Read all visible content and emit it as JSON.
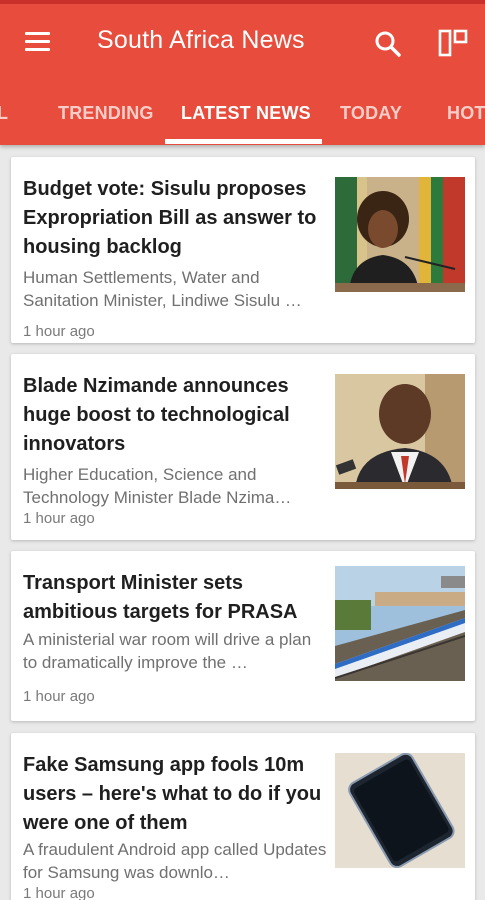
{
  "app": {
    "title": "South Africa News",
    "colors": {
      "primary": "#e74c3c",
      "status": "#c9302c"
    },
    "icons": {
      "menu": "menu-icon",
      "search": "search-icon",
      "layout": "layout-icon"
    }
  },
  "tabs": [
    {
      "label": "L",
      "active": false
    },
    {
      "label": "TRENDING",
      "active": false
    },
    {
      "label": "LATEST NEWS",
      "active": true
    },
    {
      "label": "TODAY",
      "active": false
    },
    {
      "label": "HOT",
      "active": false
    }
  ],
  "articles": [
    {
      "title": "Budget vote: Sisulu proposes Expropriation Bill as answer to housing backlog",
      "summary": "Human Settlements, Water and Sanitation Minister, Lindiwe Sisulu …",
      "time": "1 hour ago",
      "image": "woman-at-podium-photo"
    },
    {
      "title": "Blade Nzimande announces huge boost to technological innovators",
      "summary": "Higher Education, Science and Technology Minister Blade Nzima…",
      "time": "1 hour ago",
      "image": "man-at-microphone-photo"
    },
    {
      "title": "Transport Minister sets ambitious targets for PRASA",
      "summary": "A ministerial war room will drive a plan to dramatically improve the …",
      "time": "1 hour ago",
      "image": "passenger-train-photo"
    },
    {
      "title": "Fake Samsung app fools 10m users – here's what to do if you were one of them",
      "summary": "A fraudulent Android app called Updates for Samsung was downlo…",
      "time": "1 hour ago",
      "image": "smartphone-photo"
    }
  ]
}
